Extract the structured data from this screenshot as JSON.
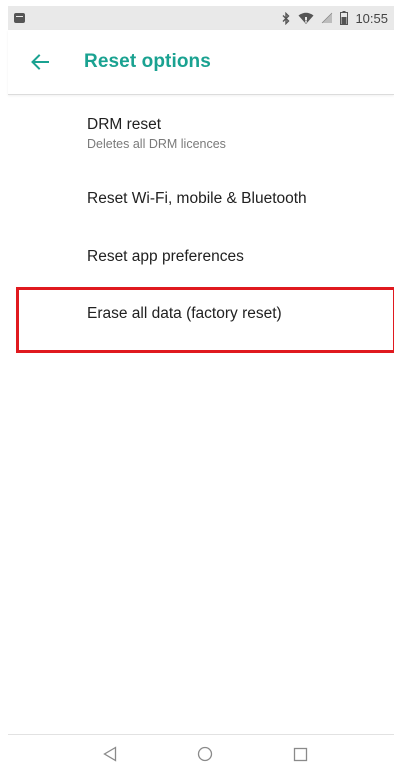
{
  "status_bar": {
    "time": "10:55",
    "icons": [
      "notification-icon",
      "bluetooth-icon",
      "wifi-icon",
      "signal-icon",
      "battery-icon"
    ]
  },
  "app_bar": {
    "title": "Reset options",
    "back_icon": "arrow-left-icon"
  },
  "list": {
    "items": [
      {
        "title": "DRM reset",
        "subtitle": "Deletes all DRM licences"
      },
      {
        "title": "Reset Wi-Fi, mobile & Bluetooth"
      },
      {
        "title": "Reset app preferences"
      },
      {
        "title": "Erase all data (factory reset)"
      }
    ]
  },
  "nav_bar": {
    "icons": [
      "back-triangle-icon",
      "home-circle-icon",
      "recents-square-icon"
    ]
  },
  "colors": {
    "accent": "#1aa291",
    "highlight": "#e0191f",
    "status_bar_bg": "#e9e9e9"
  }
}
